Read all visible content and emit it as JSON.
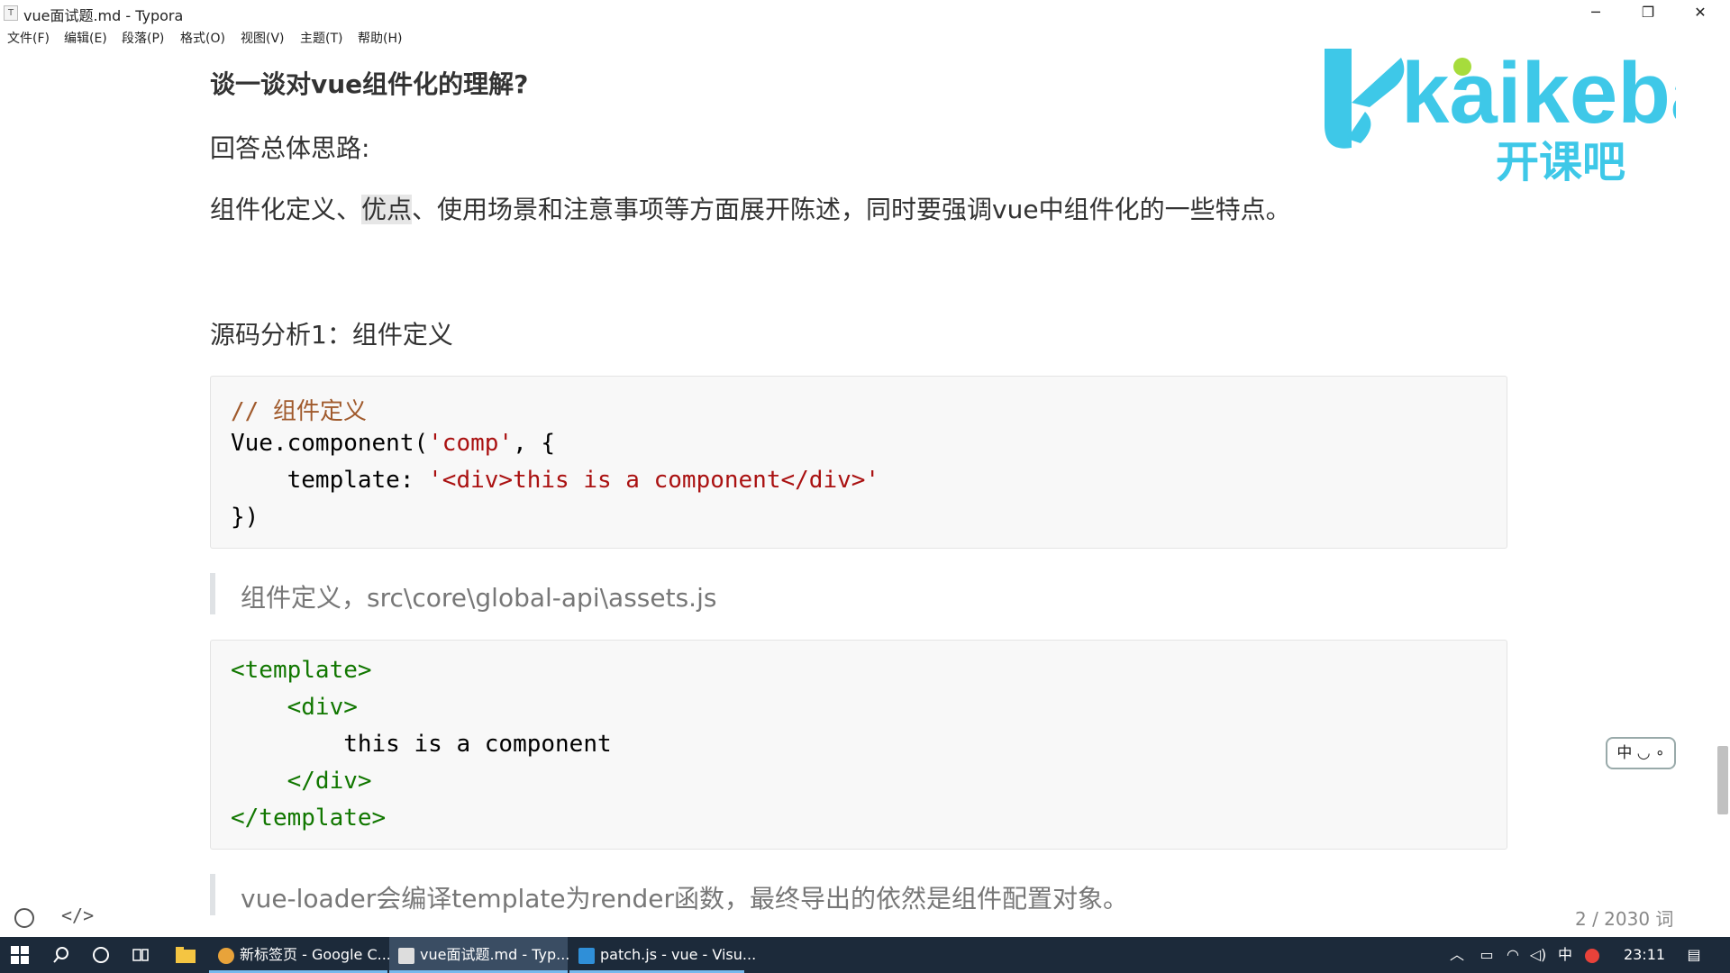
{
  "window": {
    "title": "vue面试题.md - Typora",
    "app_icon": "T",
    "min_glyph": "─",
    "max_glyph": "❐",
    "close_glyph": "✕"
  },
  "menu": [
    "文件(F)",
    "编辑(E)",
    "段落(P)",
    "格式(O)",
    "视图(V)",
    "主题(T)",
    "帮助(H)"
  ],
  "logo": {
    "text": "kaikeba",
    "subtext": "开课吧",
    "brand_color": "#3ec8e8",
    "dot_color": "#a6dc3c"
  },
  "document": {
    "heading": "谈一谈对vue组件化的理解?",
    "p1": "回答总体思路:",
    "p2_before": "组件化定义、",
    "p2_highlight": "优点",
    "p2_after": "、使用场景和注意事项等方面展开陈述，同时要强调vue中组件化的一些特点。",
    "p3": "源码分析1：组件定义",
    "code1": {
      "comment": "// 组件定义",
      "line2_a": "Vue.component(",
      "line2_str": "'comp'",
      "line2_b": ", {",
      "line3_a": "    template: ",
      "line3_str": "'<div>this is a component</div>'",
      "line4": "})"
    },
    "quote1": "组件定义，src\\core\\global-api\\assets.js",
    "code2": {
      "l1": "<template>",
      "l2": "    <div>",
      "l3": "        this is a component",
      "l4": "    </div>",
      "l5": "</template>"
    },
    "quote2": "vue-loader会编译template为render函数，最终导出的依然是组件配置对象。"
  },
  "statusbar": {
    "source_toggle": "</>",
    "word_count": "2 / 2030 词"
  },
  "ime": "中 ◡ ∘",
  "taskbar": {
    "tasks": [
      {
        "label": "新标签页 - Google C...",
        "icon_color": "#e8a33a"
      },
      {
        "label": "vue面试题.md - Typ...",
        "icon_color": "#dddddd"
      },
      {
        "label": "patch.js - vue - Visu...",
        "icon_color": "#2f8fd8"
      }
    ],
    "tray_ime": "中",
    "clock": "23:11"
  }
}
